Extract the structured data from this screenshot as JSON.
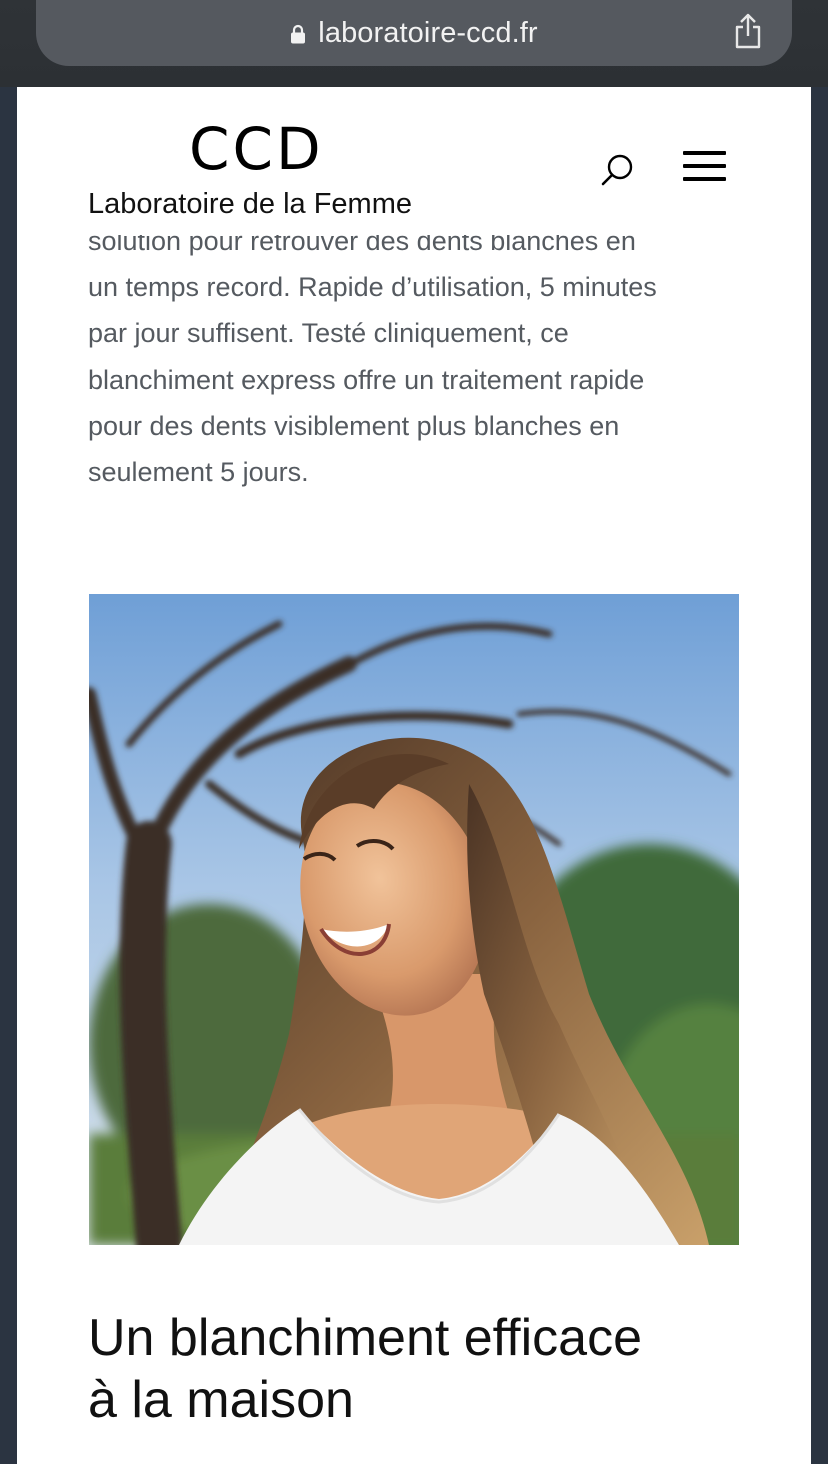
{
  "browser": {
    "url": "laboratoire-ccd.fr",
    "lock_icon": "lock-icon",
    "share_icon": "share-icon"
  },
  "header": {
    "logo": "CCD",
    "subtitle": "Laboratoire de la Femme",
    "search_icon": "search-icon",
    "menu_icon": "hamburger-menu-icon"
  },
  "article": {
    "paragraph_lines": [
      "solution pour retrouver des dents blanches en",
      "un temps record. Rapide d’utilisation, 5 minutes",
      "par jour suffisent. Testé cliniquement, ce",
      "blanchiment express offre un traitement rapide",
      "pour des dents visiblement plus blanches en",
      "seulement 5 jours."
    ],
    "headline_lines": [
      "Un blanchiment efficace",
      "à la maison"
    ]
  },
  "colors": {
    "page_bg": "#ffffff",
    "frame_bg": "#2b3441",
    "body_text": "#555a60",
    "headline": "#111111"
  }
}
